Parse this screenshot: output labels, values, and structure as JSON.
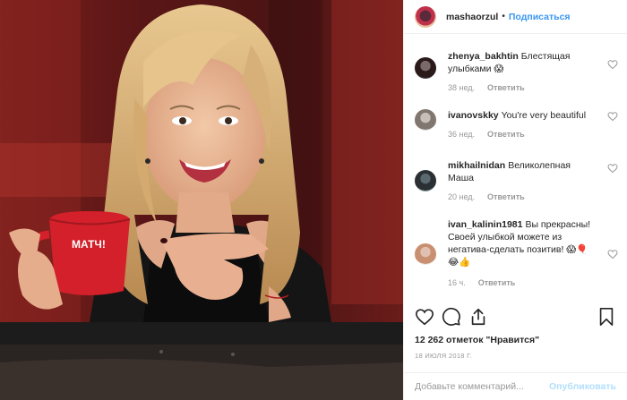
{
  "post": {
    "owner": "mashaorzul",
    "separator": "•",
    "follow_label": "Подписаться"
  },
  "comments": [
    {
      "user": "zhenya_bakhtin",
      "text": "Блестящая улыбками 😱",
      "time": "38 нед.",
      "reply": "Ответить"
    },
    {
      "user": "ivanovskky",
      "text": "You're very beautiful",
      "time": "36 нед.",
      "reply": "Ответить"
    },
    {
      "user": "mikhailnidan",
      "text": "Великолепная Маша",
      "time": "20 нед.",
      "reply": "Ответить"
    },
    {
      "user": "ivan_kalinin1981",
      "text": "Вы прекрасны! Своей улыбкой можете из негатива-сделать позитив! 😱🎈 😂👍",
      "time": "16 ч.",
      "reply": "Ответить"
    }
  ],
  "photo": {
    "mug_text": "МАТЧ!"
  },
  "likes_text": "12 262 отметок \"Нравится\"",
  "date_text": "18 ИЮЛЯ 2018 Г.",
  "add_comment": {
    "placeholder": "Добавьте комментарий...",
    "publish_label": "Опубликовать"
  },
  "icons": [
    "heart-icon",
    "comment-icon",
    "share-icon",
    "bookmark-icon"
  ],
  "colors": {
    "link_blue": "#3897f0",
    "publish_disabled": "#b2dffc",
    "muted": "#999999",
    "text": "#262626"
  }
}
